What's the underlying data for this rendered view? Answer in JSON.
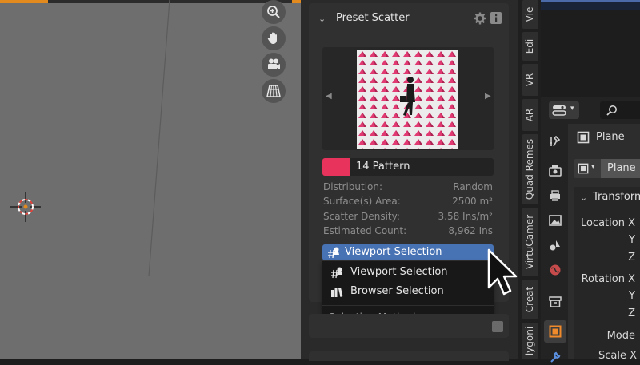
{
  "viewport": {
    "nav_buttons": [
      "zoom-icon",
      "hand-pan-icon",
      "camera-icon",
      "grid-icon"
    ]
  },
  "panel": {
    "title": "Preset Scatter",
    "preset_name": "14 Pattern",
    "preset_color": "#e8335c",
    "info": [
      {
        "label": "Distribution:",
        "value": "Random"
      },
      {
        "label": "Surface(s) Area:",
        "value": "2500 m²"
      },
      {
        "label": "Scatter Density:",
        "value": "3.58 Ins/m²"
      },
      {
        "label": "Estimated Count:",
        "value": "8,962 Ins"
      }
    ],
    "dropdown": {
      "selected": "Viewport Selection",
      "options": [
        "Viewport Selection",
        "Browser Selection"
      ],
      "tooltip": "Selection Method"
    }
  },
  "tabs": [
    "Vie",
    "Edi",
    "VR",
    "AR",
    "Quad Remes",
    "VirtuCamer",
    "Creat",
    "lygoni"
  ],
  "properties": {
    "object_name": "Plane",
    "data_name": "Plane",
    "section": "Transform",
    "rows": {
      "location_x": "Location X",
      "y1": "Y",
      "z1": "Z",
      "rotation_x": "Rotation X",
      "y2": "Y",
      "z2": "Z",
      "mode": "Mode",
      "scale_x": "Scale X"
    }
  }
}
